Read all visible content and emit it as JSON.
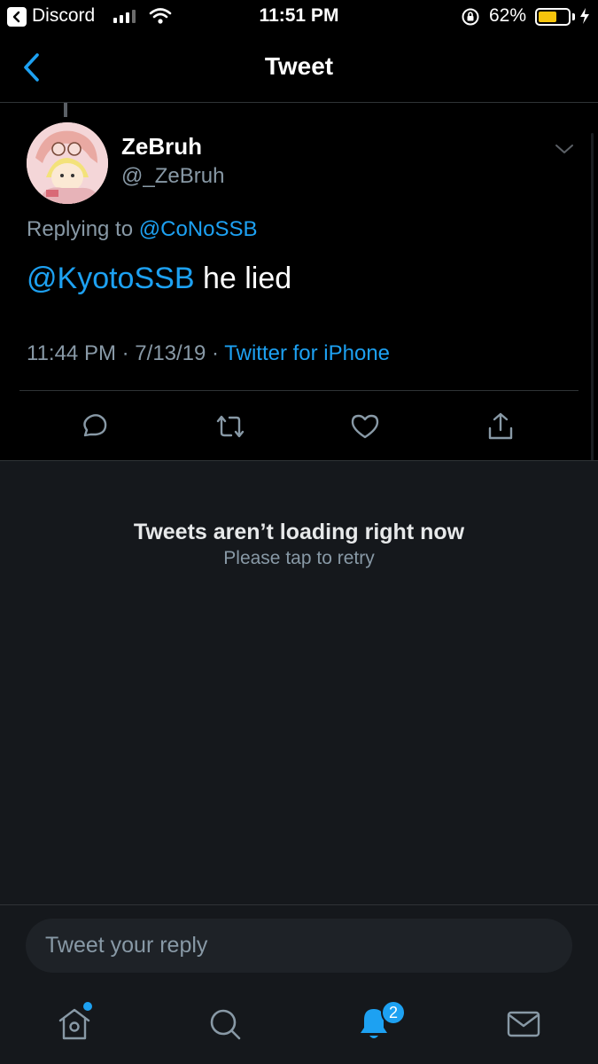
{
  "status_bar": {
    "back_app": "Discord",
    "time": "11:51 PM",
    "battery_percent": "62%",
    "battery_level": 0.62,
    "icons": [
      "back-to-app-icon",
      "signal-icon",
      "wifi-icon",
      "rotation-lock-icon",
      "battery-icon",
      "charging-bolt-icon"
    ]
  },
  "header": {
    "title": "Tweet",
    "back_icon": "chevron-left-icon"
  },
  "tweet": {
    "author_name": "ZeBruh",
    "author_handle": "@_ZeBruh",
    "replying_prefix": "Replying to",
    "replying_to": "@CoNoSSB",
    "mention": "@KyotoSSB",
    "body": "he lied",
    "time": "11:44 PM",
    "date": "7/13/19",
    "separator": "·",
    "source": "Twitter for iPhone",
    "actions": [
      "reply-icon",
      "retweet-icon",
      "like-icon",
      "share-icon"
    ]
  },
  "replies_panel": {
    "error_title": "Tweets aren’t loading right now",
    "error_subtitle": "Please tap to retry"
  },
  "composer": {
    "placeholder": "Tweet your reply"
  },
  "tab_bar": {
    "items": [
      "home-icon",
      "search-icon",
      "notifications-icon",
      "messages-icon"
    ],
    "notification_count": "2"
  },
  "colors": {
    "accent": "#1da1f2",
    "background": "#000000",
    "panel": "#15181c",
    "secondary_text": "#8899a6",
    "battery": "#f6c40c"
  }
}
